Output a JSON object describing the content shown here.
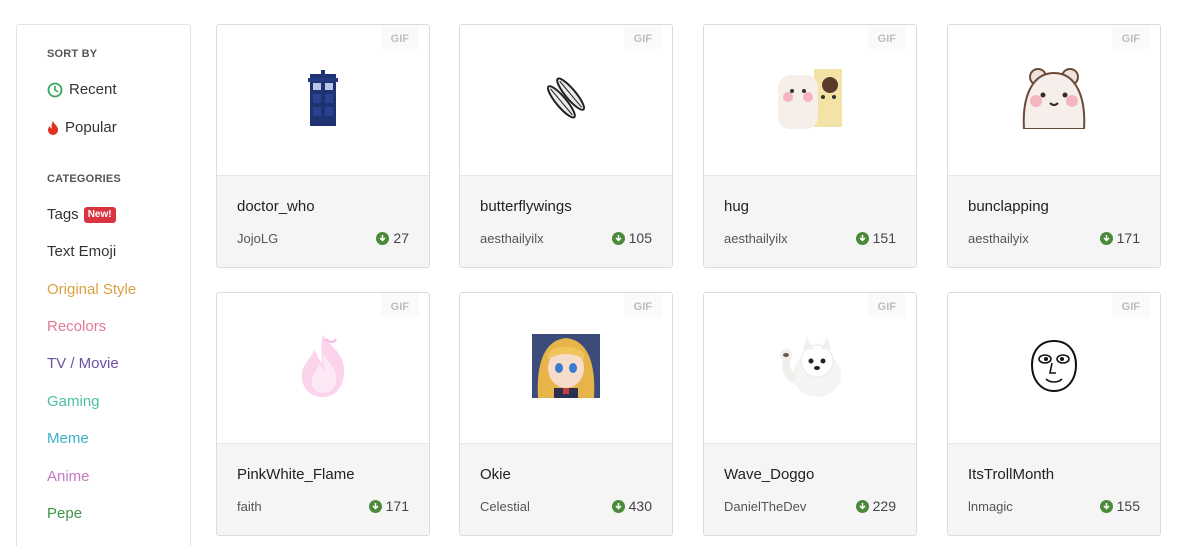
{
  "sidebar": {
    "sort_heading": "SORT BY",
    "sort_items": [
      {
        "label": "Recent",
        "icon": "clock-icon",
        "color": "#333333"
      },
      {
        "label": "Popular",
        "icon": "flame-icon",
        "color": "#333333"
      }
    ],
    "categories_heading": "CATEGORIES",
    "categories": [
      {
        "label": "Tags",
        "color": "#333333",
        "badge": "New!"
      },
      {
        "label": "Text Emoji",
        "color": "#333333"
      },
      {
        "label": "Original Style",
        "color": "#d9a23f"
      },
      {
        "label": "Recolors",
        "color": "#e07b93"
      },
      {
        "label": "TV / Movie",
        "color": "#6b4fa8"
      },
      {
        "label": "Gaming",
        "color": "#4cbfa3"
      },
      {
        "label": "Meme",
        "color": "#3ab0cc"
      },
      {
        "label": "Anime",
        "color": "#c47ac4"
      },
      {
        "label": "Pepe",
        "color": "#3f9447"
      }
    ]
  },
  "cards": [
    {
      "tag": "GIF",
      "name": "doctor_who",
      "author": "JojoLG",
      "downloads": "27",
      "icon": "tardis-icon"
    },
    {
      "tag": "GIF",
      "name": "butterflywings",
      "author": "aesthailyilx",
      "downloads": "105",
      "icon": "wings-icon"
    },
    {
      "tag": "GIF",
      "name": "hug",
      "author": "aesthailyilx",
      "downloads": "151",
      "icon": "hug-bears-icon"
    },
    {
      "tag": "GIF",
      "name": "bunclapping",
      "author": "aesthailyix",
      "downloads": "171",
      "icon": "bear-clapping-icon"
    },
    {
      "tag": "GIF",
      "name": "PinkWhite_Flame",
      "author": "faith",
      "downloads": "171",
      "icon": "pink-flame-icon"
    },
    {
      "tag": "GIF",
      "name": "Okie",
      "author": "Celestial",
      "downloads": "430",
      "icon": "anime-girl-icon"
    },
    {
      "tag": "GIF",
      "name": "Wave_Doggo",
      "author": "DanielTheDev",
      "downloads": "229",
      "icon": "waving-dog-icon"
    },
    {
      "tag": "GIF",
      "name": "ItsTrollMonth",
      "author": "lnmagic",
      "downloads": "155",
      "icon": "troll-face-icon"
    }
  ],
  "colors": {
    "download_icon": "#4a8a3a",
    "badge_new": "#d9333f",
    "recent_icon": "#3aa55d",
    "popular_icon": "#e0311f"
  }
}
